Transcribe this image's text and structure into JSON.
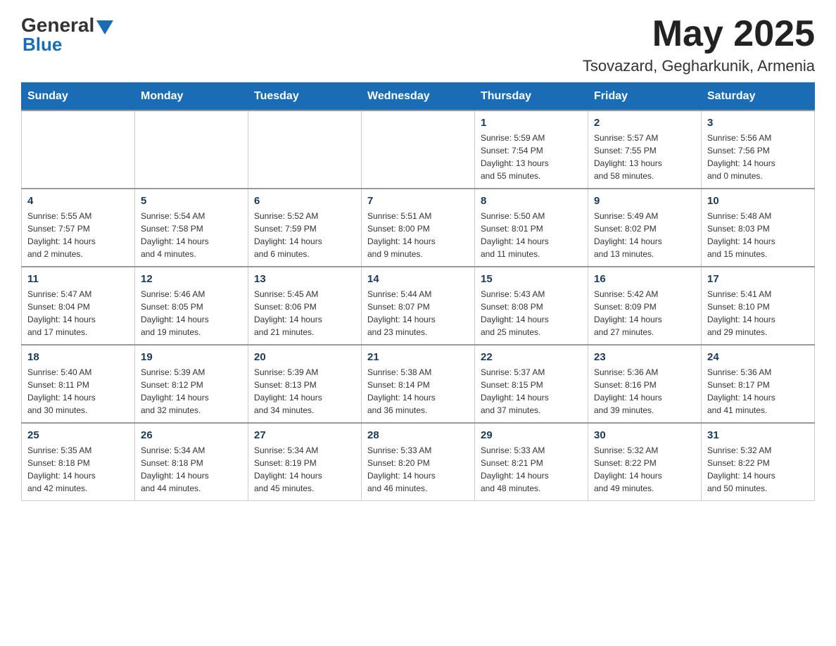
{
  "header": {
    "logo_general": "General",
    "logo_blue": "Blue",
    "month_title": "May 2025",
    "location": "Tsovazard, Gegharkunik, Armenia"
  },
  "days_of_week": [
    "Sunday",
    "Monday",
    "Tuesday",
    "Wednesday",
    "Thursday",
    "Friday",
    "Saturday"
  ],
  "weeks": [
    {
      "days": [
        {
          "num": "",
          "info": ""
        },
        {
          "num": "",
          "info": ""
        },
        {
          "num": "",
          "info": ""
        },
        {
          "num": "",
          "info": ""
        },
        {
          "num": "1",
          "info": "Sunrise: 5:59 AM\nSunset: 7:54 PM\nDaylight: 13 hours\nand 55 minutes."
        },
        {
          "num": "2",
          "info": "Sunrise: 5:57 AM\nSunset: 7:55 PM\nDaylight: 13 hours\nand 58 minutes."
        },
        {
          "num": "3",
          "info": "Sunrise: 5:56 AM\nSunset: 7:56 PM\nDaylight: 14 hours\nand 0 minutes."
        }
      ]
    },
    {
      "days": [
        {
          "num": "4",
          "info": "Sunrise: 5:55 AM\nSunset: 7:57 PM\nDaylight: 14 hours\nand 2 minutes."
        },
        {
          "num": "5",
          "info": "Sunrise: 5:54 AM\nSunset: 7:58 PM\nDaylight: 14 hours\nand 4 minutes."
        },
        {
          "num": "6",
          "info": "Sunrise: 5:52 AM\nSunset: 7:59 PM\nDaylight: 14 hours\nand 6 minutes."
        },
        {
          "num": "7",
          "info": "Sunrise: 5:51 AM\nSunset: 8:00 PM\nDaylight: 14 hours\nand 9 minutes."
        },
        {
          "num": "8",
          "info": "Sunrise: 5:50 AM\nSunset: 8:01 PM\nDaylight: 14 hours\nand 11 minutes."
        },
        {
          "num": "9",
          "info": "Sunrise: 5:49 AM\nSunset: 8:02 PM\nDaylight: 14 hours\nand 13 minutes."
        },
        {
          "num": "10",
          "info": "Sunrise: 5:48 AM\nSunset: 8:03 PM\nDaylight: 14 hours\nand 15 minutes."
        }
      ]
    },
    {
      "days": [
        {
          "num": "11",
          "info": "Sunrise: 5:47 AM\nSunset: 8:04 PM\nDaylight: 14 hours\nand 17 minutes."
        },
        {
          "num": "12",
          "info": "Sunrise: 5:46 AM\nSunset: 8:05 PM\nDaylight: 14 hours\nand 19 minutes."
        },
        {
          "num": "13",
          "info": "Sunrise: 5:45 AM\nSunset: 8:06 PM\nDaylight: 14 hours\nand 21 minutes."
        },
        {
          "num": "14",
          "info": "Sunrise: 5:44 AM\nSunset: 8:07 PM\nDaylight: 14 hours\nand 23 minutes."
        },
        {
          "num": "15",
          "info": "Sunrise: 5:43 AM\nSunset: 8:08 PM\nDaylight: 14 hours\nand 25 minutes."
        },
        {
          "num": "16",
          "info": "Sunrise: 5:42 AM\nSunset: 8:09 PM\nDaylight: 14 hours\nand 27 minutes."
        },
        {
          "num": "17",
          "info": "Sunrise: 5:41 AM\nSunset: 8:10 PM\nDaylight: 14 hours\nand 29 minutes."
        }
      ]
    },
    {
      "days": [
        {
          "num": "18",
          "info": "Sunrise: 5:40 AM\nSunset: 8:11 PM\nDaylight: 14 hours\nand 30 minutes."
        },
        {
          "num": "19",
          "info": "Sunrise: 5:39 AM\nSunset: 8:12 PM\nDaylight: 14 hours\nand 32 minutes."
        },
        {
          "num": "20",
          "info": "Sunrise: 5:39 AM\nSunset: 8:13 PM\nDaylight: 14 hours\nand 34 minutes."
        },
        {
          "num": "21",
          "info": "Sunrise: 5:38 AM\nSunset: 8:14 PM\nDaylight: 14 hours\nand 36 minutes."
        },
        {
          "num": "22",
          "info": "Sunrise: 5:37 AM\nSunset: 8:15 PM\nDaylight: 14 hours\nand 37 minutes."
        },
        {
          "num": "23",
          "info": "Sunrise: 5:36 AM\nSunset: 8:16 PM\nDaylight: 14 hours\nand 39 minutes."
        },
        {
          "num": "24",
          "info": "Sunrise: 5:36 AM\nSunset: 8:17 PM\nDaylight: 14 hours\nand 41 minutes."
        }
      ]
    },
    {
      "days": [
        {
          "num": "25",
          "info": "Sunrise: 5:35 AM\nSunset: 8:18 PM\nDaylight: 14 hours\nand 42 minutes."
        },
        {
          "num": "26",
          "info": "Sunrise: 5:34 AM\nSunset: 8:18 PM\nDaylight: 14 hours\nand 44 minutes."
        },
        {
          "num": "27",
          "info": "Sunrise: 5:34 AM\nSunset: 8:19 PM\nDaylight: 14 hours\nand 45 minutes."
        },
        {
          "num": "28",
          "info": "Sunrise: 5:33 AM\nSunset: 8:20 PM\nDaylight: 14 hours\nand 46 minutes."
        },
        {
          "num": "29",
          "info": "Sunrise: 5:33 AM\nSunset: 8:21 PM\nDaylight: 14 hours\nand 48 minutes."
        },
        {
          "num": "30",
          "info": "Sunrise: 5:32 AM\nSunset: 8:22 PM\nDaylight: 14 hours\nand 49 minutes."
        },
        {
          "num": "31",
          "info": "Sunrise: 5:32 AM\nSunset: 8:22 PM\nDaylight: 14 hours\nand 50 minutes."
        }
      ]
    }
  ]
}
